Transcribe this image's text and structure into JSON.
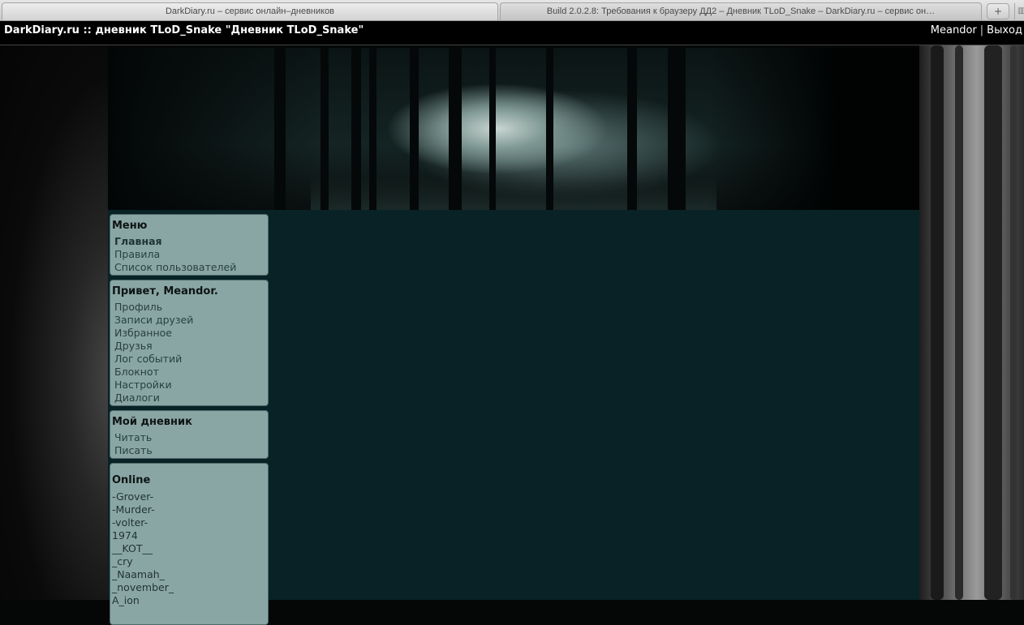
{
  "browser": {
    "tabs": [
      {
        "title": "DarkDiary.ru – сервис онлайн–дневников"
      },
      {
        "title": "Build 2.0.2.8: Требования к браузеру ДД2 – Дневник TLoD_Snake – DarkDiary.ru – сервис он…"
      }
    ],
    "new_tab_symbol": "+"
  },
  "header": {
    "title": "DarkDiary.ru :: дневник TLoD_Snake \"Дневник TLoD_Snake\"",
    "user_link": "Meandor",
    "separator": "|",
    "logout_link": "Выход"
  },
  "sidebar": {
    "menu": {
      "heading": "Меню",
      "items": [
        "Главная",
        "Правила",
        "Список пользователей"
      ]
    },
    "user": {
      "heading": "Привет, Meandor.",
      "items": [
        "Профиль",
        "Записи друзей",
        "Избранное",
        "Друзья",
        "Лог событий",
        "Блокнот",
        "Настройки",
        "Диалоги"
      ]
    },
    "diary": {
      "heading": "Мой дневник",
      "items": [
        "Читать",
        "Писать"
      ]
    },
    "online": {
      "heading": "Online",
      "users": [
        "-Grover-",
        "-Murder-",
        "-volter-",
        "1974",
        "__KOT__",
        "_cry",
        "_Naamah_",
        "_november_",
        "A_ion"
      ]
    }
  },
  "colors": {
    "page_bg": "#082225",
    "sidebar_box": "#8aa6a4",
    "link_text": "#27403f",
    "header_bg": "#000000"
  }
}
